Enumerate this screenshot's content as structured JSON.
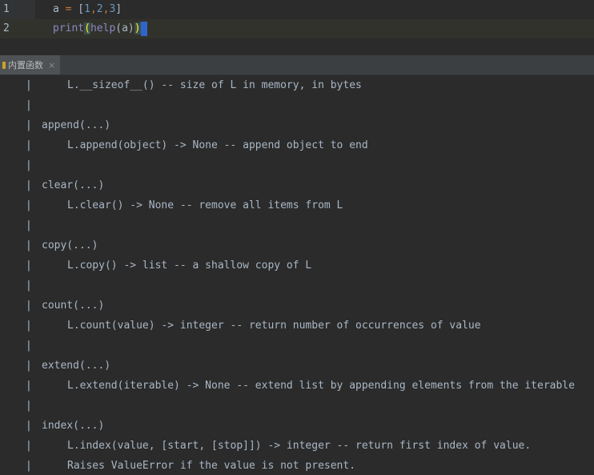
{
  "editor": {
    "lines": [
      {
        "number": "1",
        "parts": [
          {
            "t": "a ",
            "c": ""
          },
          {
            "t": "=",
            "c": "op"
          },
          {
            "t": " [",
            "c": ""
          },
          {
            "t": "1",
            "c": "num"
          },
          {
            "t": ",",
            "c": "op"
          },
          {
            "t": "2",
            "c": "num"
          },
          {
            "t": ",",
            "c": "op"
          },
          {
            "t": "3",
            "c": "num"
          },
          {
            "t": "]",
            "c": ""
          }
        ]
      },
      {
        "number": "2",
        "parts": [
          {
            "t": "print",
            "c": "builtin"
          },
          {
            "t": "(",
            "c": "paren-match"
          },
          {
            "t": "help",
            "c": "builtin"
          },
          {
            "t": "(a)",
            "c": ""
          },
          {
            "t": ")",
            "c": "paren-match"
          }
        ]
      }
    ]
  },
  "tool_window": {
    "tab_label": "内置函数",
    "close_glyph": "×"
  },
  "output": {
    "bar": "|",
    "lines": [
      {
        "text": "L.__sizeof__() -- size of L in memory, in bytes",
        "indent": true
      },
      {
        "text": "",
        "indent": false
      },
      {
        "text": "append(...)",
        "indent": false
      },
      {
        "text": "L.append(object) -> None -- append object to end",
        "indent": true
      },
      {
        "text": "",
        "indent": false
      },
      {
        "text": "clear(...)",
        "indent": false
      },
      {
        "text": "L.clear() -> None -- remove all items from L",
        "indent": true
      },
      {
        "text": "",
        "indent": false
      },
      {
        "text": "copy(...)",
        "indent": false
      },
      {
        "text": "L.copy() -> list -- a shallow copy of L",
        "indent": true
      },
      {
        "text": "",
        "indent": false
      },
      {
        "text": "count(...)",
        "indent": false
      },
      {
        "text": "L.count(value) -> integer -- return number of occurrences of value",
        "indent": true
      },
      {
        "text": "",
        "indent": false
      },
      {
        "text": "extend(...)",
        "indent": false
      },
      {
        "text": "L.extend(iterable) -> None -- extend list by appending elements from the iterable",
        "indent": true
      },
      {
        "text": "",
        "indent": false
      },
      {
        "text": "index(...)",
        "indent": false
      },
      {
        "text": "L.index(value, [start, [stop]]) -> integer -- return first index of value.",
        "indent": true
      },
      {
        "text": "Raises ValueError if the value is not present.",
        "indent": true
      }
    ]
  }
}
